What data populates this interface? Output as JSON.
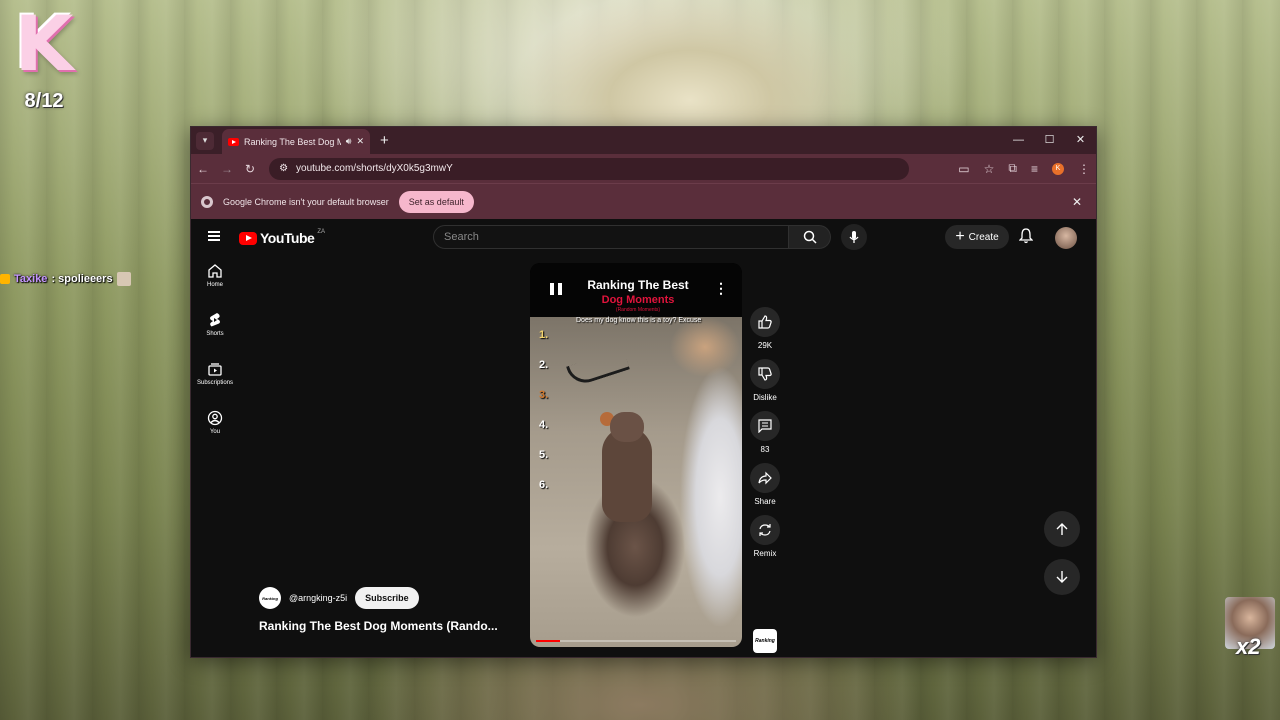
{
  "overlay": {
    "k_letter": "K",
    "counter": "8/12",
    "chat": {
      "user": "Taxike",
      "message": " : spolieeers"
    },
    "multiplier": "x2"
  },
  "browser": {
    "tab_title": "Ranking The Best Dog Mom",
    "url": "youtube.com/shorts/dyX0k5g3mwY",
    "profile_initial": "K",
    "infobar_text": "Google Chrome isn't your default browser",
    "set_default_label": "Set as default"
  },
  "youtube": {
    "logo_text": "YouTube",
    "country_code": "ZA",
    "search_placeholder": "Search",
    "create_label": "Create",
    "nav": [
      {
        "label": "Home",
        "icon": "home-icon"
      },
      {
        "label": "Shorts",
        "icon": "shorts-icon"
      },
      {
        "label": "Subscriptions",
        "icon": "subscriptions-icon"
      },
      {
        "label": "You",
        "icon": "you-icon"
      }
    ],
    "video": {
      "title_line1": "Ranking The Best",
      "title_line2": "Dog Moments",
      "title_line3": "(Random Moments)",
      "caption": "Does my dog know this is a toy? Excuse",
      "ranks": [
        "1.",
        "2.",
        "3.",
        "4.",
        "5.",
        "6."
      ],
      "progress": 0.12
    },
    "actions": {
      "like_count": "29K",
      "dislike_label": "Dislike",
      "comment_count": "83",
      "share_label": "Share",
      "remix_label": "Remix"
    },
    "channel": {
      "handle": "@arngking-z5i",
      "subscribe_label": "Subscribe",
      "thumb_text": "Ranking",
      "short_title": "Ranking The Best Dog Moments (Rando..."
    }
  }
}
